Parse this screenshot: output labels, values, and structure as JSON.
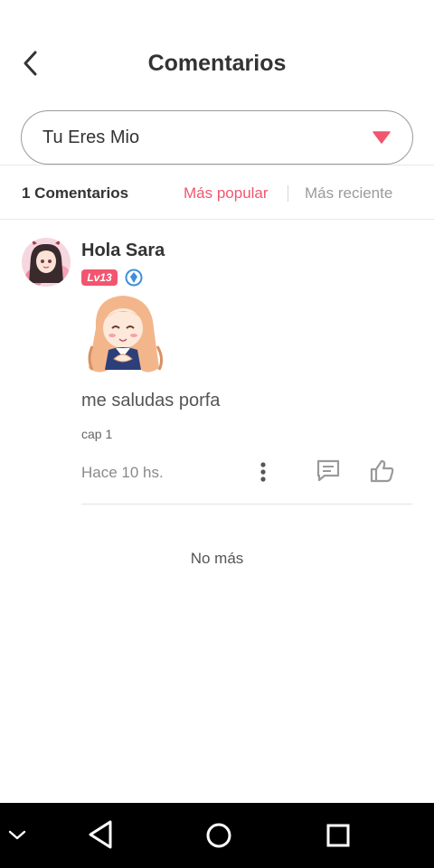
{
  "header": {
    "title": "Comentarios",
    "back_icon": "chevron-left-icon"
  },
  "story_selector": {
    "selected": "Tu Eres Mio",
    "dropdown_icon": "caret-down-icon",
    "accent_color": "#f2566f"
  },
  "filter_bar": {
    "count_label": "1 Comentarios",
    "tabs": [
      {
        "label": "Más popular",
        "active": true
      },
      {
        "label": "Más reciente",
        "active": false
      }
    ]
  },
  "comments": [
    {
      "author": "Hola Sara",
      "level_badge": "Lv13",
      "verified_icon": "diamond-badge-icon",
      "sticker": "anime-girl-sticker",
      "text": "me saludas porfa",
      "chapter": "cap 1",
      "timestamp": "Hace 10 hs.",
      "actions": [
        "more-icon",
        "reply-icon",
        "like-icon"
      ]
    }
  ],
  "footer_text": "No más",
  "system_nav": {
    "icons": [
      "hide-nav-icon",
      "back-triangle-icon",
      "home-circle-icon",
      "recents-square-icon"
    ]
  }
}
